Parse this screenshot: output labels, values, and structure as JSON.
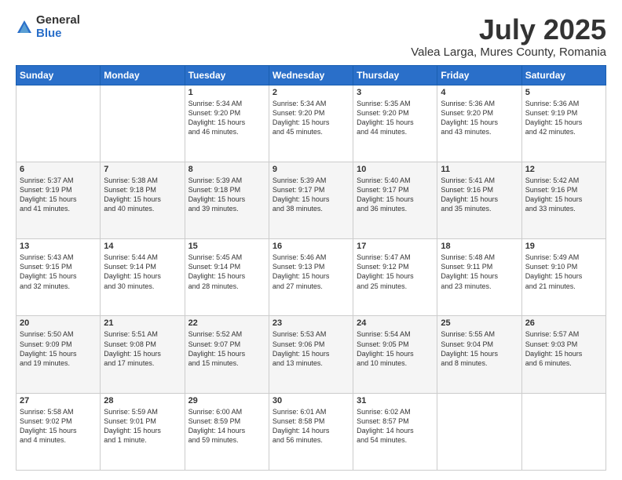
{
  "logo": {
    "general": "General",
    "blue": "Blue"
  },
  "header": {
    "title": "July 2025",
    "subtitle": "Valea Larga, Mures County, Romania"
  },
  "days_of_week": [
    "Sunday",
    "Monday",
    "Tuesday",
    "Wednesday",
    "Thursday",
    "Friday",
    "Saturday"
  ],
  "weeks": [
    [
      {
        "day": "",
        "info": ""
      },
      {
        "day": "",
        "info": ""
      },
      {
        "day": "1",
        "info": "Sunrise: 5:34 AM\nSunset: 9:20 PM\nDaylight: 15 hours\nand 46 minutes."
      },
      {
        "day": "2",
        "info": "Sunrise: 5:34 AM\nSunset: 9:20 PM\nDaylight: 15 hours\nand 45 minutes."
      },
      {
        "day": "3",
        "info": "Sunrise: 5:35 AM\nSunset: 9:20 PM\nDaylight: 15 hours\nand 44 minutes."
      },
      {
        "day": "4",
        "info": "Sunrise: 5:36 AM\nSunset: 9:20 PM\nDaylight: 15 hours\nand 43 minutes."
      },
      {
        "day": "5",
        "info": "Sunrise: 5:36 AM\nSunset: 9:19 PM\nDaylight: 15 hours\nand 42 minutes."
      }
    ],
    [
      {
        "day": "6",
        "info": "Sunrise: 5:37 AM\nSunset: 9:19 PM\nDaylight: 15 hours\nand 41 minutes."
      },
      {
        "day": "7",
        "info": "Sunrise: 5:38 AM\nSunset: 9:18 PM\nDaylight: 15 hours\nand 40 minutes."
      },
      {
        "day": "8",
        "info": "Sunrise: 5:39 AM\nSunset: 9:18 PM\nDaylight: 15 hours\nand 39 minutes."
      },
      {
        "day": "9",
        "info": "Sunrise: 5:39 AM\nSunset: 9:17 PM\nDaylight: 15 hours\nand 38 minutes."
      },
      {
        "day": "10",
        "info": "Sunrise: 5:40 AM\nSunset: 9:17 PM\nDaylight: 15 hours\nand 36 minutes."
      },
      {
        "day": "11",
        "info": "Sunrise: 5:41 AM\nSunset: 9:16 PM\nDaylight: 15 hours\nand 35 minutes."
      },
      {
        "day": "12",
        "info": "Sunrise: 5:42 AM\nSunset: 9:16 PM\nDaylight: 15 hours\nand 33 minutes."
      }
    ],
    [
      {
        "day": "13",
        "info": "Sunrise: 5:43 AM\nSunset: 9:15 PM\nDaylight: 15 hours\nand 32 minutes."
      },
      {
        "day": "14",
        "info": "Sunrise: 5:44 AM\nSunset: 9:14 PM\nDaylight: 15 hours\nand 30 minutes."
      },
      {
        "day": "15",
        "info": "Sunrise: 5:45 AM\nSunset: 9:14 PM\nDaylight: 15 hours\nand 28 minutes."
      },
      {
        "day": "16",
        "info": "Sunrise: 5:46 AM\nSunset: 9:13 PM\nDaylight: 15 hours\nand 27 minutes."
      },
      {
        "day": "17",
        "info": "Sunrise: 5:47 AM\nSunset: 9:12 PM\nDaylight: 15 hours\nand 25 minutes."
      },
      {
        "day": "18",
        "info": "Sunrise: 5:48 AM\nSunset: 9:11 PM\nDaylight: 15 hours\nand 23 minutes."
      },
      {
        "day": "19",
        "info": "Sunrise: 5:49 AM\nSunset: 9:10 PM\nDaylight: 15 hours\nand 21 minutes."
      }
    ],
    [
      {
        "day": "20",
        "info": "Sunrise: 5:50 AM\nSunset: 9:09 PM\nDaylight: 15 hours\nand 19 minutes."
      },
      {
        "day": "21",
        "info": "Sunrise: 5:51 AM\nSunset: 9:08 PM\nDaylight: 15 hours\nand 17 minutes."
      },
      {
        "day": "22",
        "info": "Sunrise: 5:52 AM\nSunset: 9:07 PM\nDaylight: 15 hours\nand 15 minutes."
      },
      {
        "day": "23",
        "info": "Sunrise: 5:53 AM\nSunset: 9:06 PM\nDaylight: 15 hours\nand 13 minutes."
      },
      {
        "day": "24",
        "info": "Sunrise: 5:54 AM\nSunset: 9:05 PM\nDaylight: 15 hours\nand 10 minutes."
      },
      {
        "day": "25",
        "info": "Sunrise: 5:55 AM\nSunset: 9:04 PM\nDaylight: 15 hours\nand 8 minutes."
      },
      {
        "day": "26",
        "info": "Sunrise: 5:57 AM\nSunset: 9:03 PM\nDaylight: 15 hours\nand 6 minutes."
      }
    ],
    [
      {
        "day": "27",
        "info": "Sunrise: 5:58 AM\nSunset: 9:02 PM\nDaylight: 15 hours\nand 4 minutes."
      },
      {
        "day": "28",
        "info": "Sunrise: 5:59 AM\nSunset: 9:01 PM\nDaylight: 15 hours\nand 1 minute."
      },
      {
        "day": "29",
        "info": "Sunrise: 6:00 AM\nSunset: 8:59 PM\nDaylight: 14 hours\nand 59 minutes."
      },
      {
        "day": "30",
        "info": "Sunrise: 6:01 AM\nSunset: 8:58 PM\nDaylight: 14 hours\nand 56 minutes."
      },
      {
        "day": "31",
        "info": "Sunrise: 6:02 AM\nSunset: 8:57 PM\nDaylight: 14 hours\nand 54 minutes."
      },
      {
        "day": "",
        "info": ""
      },
      {
        "day": "",
        "info": ""
      }
    ]
  ]
}
